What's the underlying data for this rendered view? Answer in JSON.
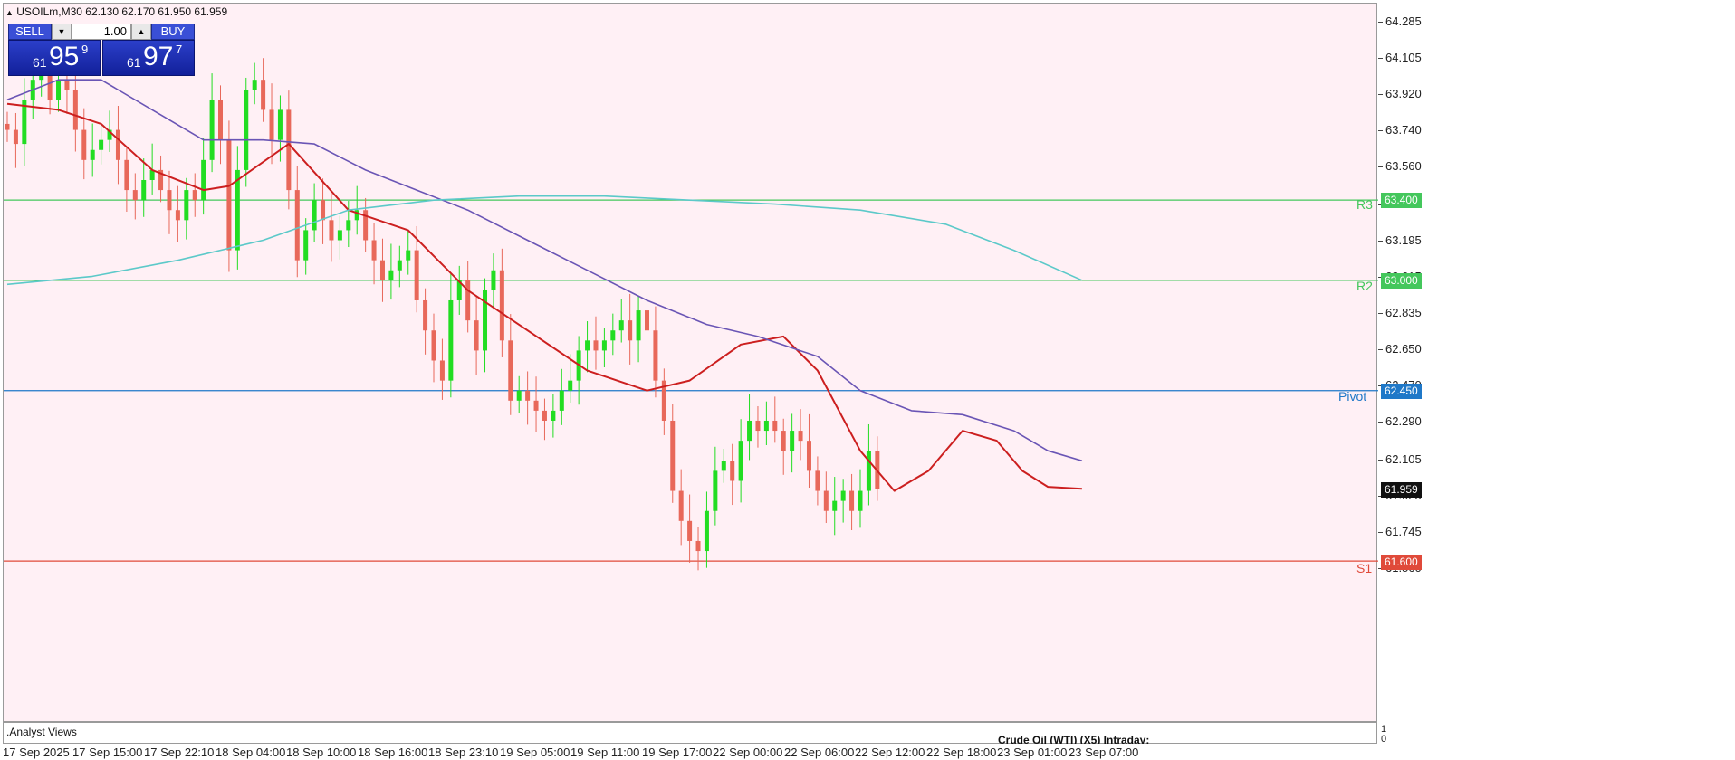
{
  "header": {
    "title": "USOILm,M30",
    "ohlc": "62.130 62.170 61.950 61.959"
  },
  "trade_panel": {
    "sell_label": "SELL",
    "buy_label": "BUY",
    "lot_value": "1.00",
    "sell_price": {
      "prefix": "61",
      "big": "95",
      "sup": "9"
    },
    "buy_price": {
      "prefix": "61",
      "big": "97",
      "sup": "7"
    }
  },
  "colors": {
    "bull": "#22dd22",
    "bear": "#e8685a",
    "ema_fast": "#cc1f1f",
    "ma_mid": "#6a55b5",
    "ma_slow": "#5cc9c9",
    "r3": "#44c75c",
    "r2": "#44c75c",
    "pivot": "#1f78c8",
    "s1": "#e04a3a",
    "current": "#9a9a9a"
  },
  "price_axis": {
    "ticks": [
      "64.285",
      "64.105",
      "63.920",
      "63.740",
      "63.560",
      "63.375",
      "63.195",
      "63.015",
      "62.835",
      "62.650",
      "62.470",
      "62.290",
      "62.105",
      "61.925",
      "61.745",
      "61.560"
    ],
    "current_price": "61.959"
  },
  "levels": [
    {
      "name": "R3",
      "value": "63.400"
    },
    {
      "name": "R2",
      "value": "63.000"
    },
    {
      "name": "Pivot",
      "value": "62.450"
    },
    {
      "name": "S1",
      "value": "61.600"
    }
  ],
  "time_axis": [
    "17 Sep 2025",
    "17 Sep 15:00",
    "17 Sep 22:10",
    "18 Sep 04:00",
    "18 Sep 10:00",
    "18 Sep 16:00",
    "18 Sep 23:10",
    "19 Sep 05:00",
    "19 Sep 11:00",
    "19 Sep 17:00",
    "22 Sep 00:00",
    "22 Sep 06:00",
    "22 Sep 12:00",
    "22 Sep 18:00",
    "23 Sep 01:00",
    "23 Sep 07:00"
  ],
  "subwindow": {
    "label": ".Analyst Views",
    "scale_top": "1",
    "scale_bottom": "0",
    "bottom_text": "Crude Oil (WTI) (X5) Intraday:"
  },
  "chart_data": {
    "type": "candlestick",
    "symbol": "USOILm",
    "timeframe": "M30",
    "ylim": [
      61.52,
      64.33
    ],
    "closes": [
      63.75,
      63.68,
      63.9,
      64.0,
      64.05,
      63.9,
      64.0,
      63.95,
      63.75,
      63.6,
      63.65,
      63.7,
      63.75,
      63.6,
      63.45,
      63.4,
      63.5,
      63.55,
      63.45,
      63.35,
      63.3,
      63.45,
      63.4,
      63.6,
      63.9,
      63.7,
      63.15,
      63.55,
      63.95,
      64.0,
      63.85,
      63.7,
      63.85,
      63.45,
      63.1,
      63.25,
      63.4,
      63.3,
      63.2,
      63.25,
      63.3,
      63.35,
      63.2,
      63.1,
      63.0,
      63.05,
      63.1,
      63.15,
      62.9,
      62.75,
      62.6,
      62.5,
      62.9,
      63.0,
      62.8,
      62.65,
      62.95,
      63.05,
      62.7,
      62.4,
      62.45,
      62.4,
      62.35,
      62.3,
      62.35,
      62.45,
      62.5,
      62.65,
      62.7,
      62.65,
      62.7,
      62.75,
      62.8,
      62.7,
      62.85,
      62.75,
      62.5,
      62.3,
      61.95,
      61.8,
      61.7,
      61.65,
      61.85,
      62.05,
      62.1,
      62.0,
      62.2,
      62.3,
      62.25,
      62.3,
      62.25,
      62.15,
      62.25,
      62.2,
      62.05,
      61.95,
      61.85,
      61.9,
      61.95,
      61.85,
      61.95,
      62.15,
      61.96
    ],
    "series": [
      {
        "name": "EMA fast",
        "points": [
          [
            0,
            63.88
          ],
          [
            6,
            63.85
          ],
          [
            11,
            63.78
          ],
          [
            17,
            63.55
          ],
          [
            23,
            63.45
          ],
          [
            26,
            63.47
          ],
          [
            33,
            63.68
          ],
          [
            40,
            63.35
          ],
          [
            47,
            63.25
          ],
          [
            54,
            62.95
          ],
          [
            61,
            62.75
          ],
          [
            68,
            62.55
          ],
          [
            75,
            62.45
          ],
          [
            80,
            62.5
          ],
          [
            86,
            62.68
          ],
          [
            91,
            62.72
          ],
          [
            95,
            62.55
          ],
          [
            100,
            62.15
          ],
          [
            104,
            61.95
          ],
          [
            108,
            62.05
          ],
          [
            112,
            62.25
          ],
          [
            116,
            62.2
          ],
          [
            119,
            62.05
          ],
          [
            122,
            61.97
          ],
          [
            126,
            61.96
          ]
        ]
      },
      {
        "name": "MA mid",
        "points": [
          [
            0,
            63.9
          ],
          [
            6,
            64.0
          ],
          [
            11,
            64.0
          ],
          [
            17,
            63.85
          ],
          [
            23,
            63.7
          ],
          [
            30,
            63.7
          ],
          [
            36,
            63.68
          ],
          [
            42,
            63.55
          ],
          [
            48,
            63.45
          ],
          [
            54,
            63.35
          ],
          [
            61,
            63.2
          ],
          [
            68,
            63.05
          ],
          [
            75,
            62.9
          ],
          [
            82,
            62.78
          ],
          [
            88,
            62.72
          ],
          [
            95,
            62.62
          ],
          [
            100,
            62.45
          ],
          [
            106,
            62.35
          ],
          [
            112,
            62.33
          ],
          [
            118,
            62.25
          ],
          [
            122,
            62.15
          ],
          [
            126,
            62.1
          ]
        ]
      },
      {
        "name": "MA slow",
        "points": [
          [
            0,
            62.98
          ],
          [
            10,
            63.02
          ],
          [
            20,
            63.1
          ],
          [
            30,
            63.2
          ],
          [
            40,
            63.35
          ],
          [
            50,
            63.4
          ],
          [
            60,
            63.42
          ],
          [
            70,
            63.42
          ],
          [
            80,
            63.4
          ],
          [
            90,
            63.38
          ],
          [
            100,
            63.35
          ],
          [
            110,
            63.28
          ],
          [
            118,
            63.15
          ],
          [
            126,
            63.0
          ]
        ]
      }
    ]
  }
}
